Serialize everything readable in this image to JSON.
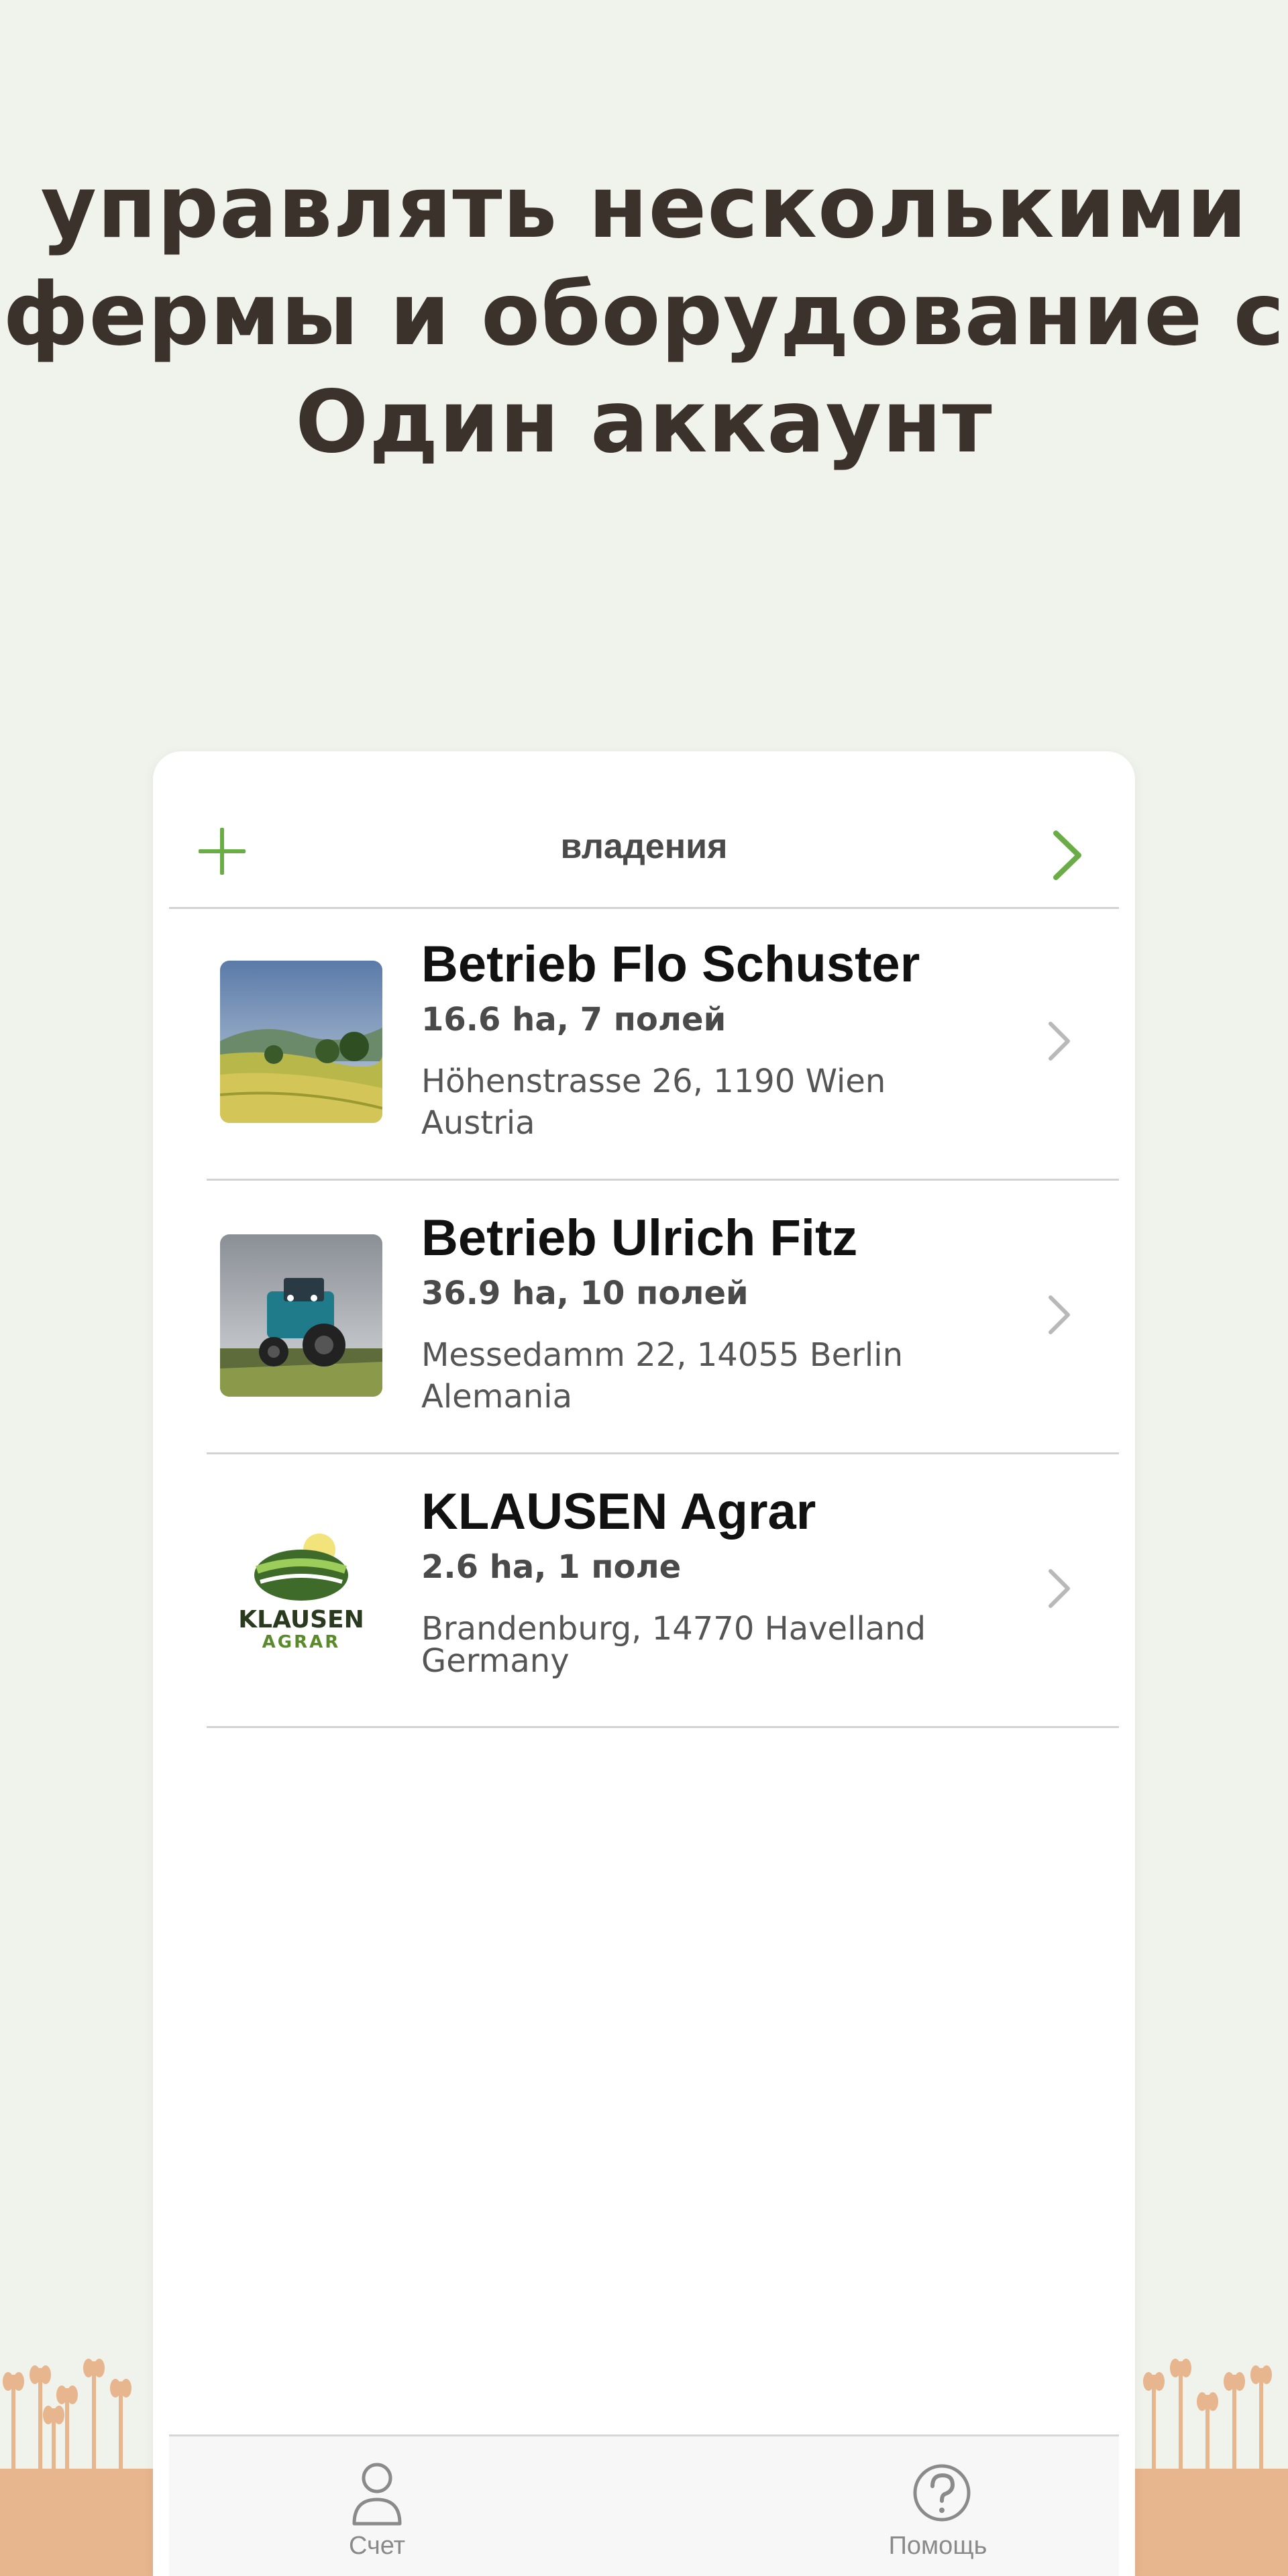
{
  "headline": {
    "line1": "управлять несколькими",
    "line2": "фермы и оборудование с",
    "line3": "Один аккаунт"
  },
  "header": {
    "title": "владения"
  },
  "farms": [
    {
      "name": "Betrieb Flo Schuster",
      "meta": "16.6 ha, 7 полей",
      "address_line1": "Höhenstrasse 26, 1190 Wien",
      "address_line2": "Austria",
      "thumbnail": "landscape-photo"
    },
    {
      "name": "Betrieb Ulrich Fitz",
      "meta": "36.9 ha, 10 полей",
      "address_line1": "Messedamm 22, 14055 Berlin",
      "address_line2": "Alemania",
      "thumbnail": "tractor-photo"
    },
    {
      "name": "KLAUSEN Agrar",
      "meta": "2.6 ha, 1 поле",
      "address_line1": "Brandenburg, 14770  Havelland",
      "address_line2": "Germany",
      "thumbnail": "klausen-logo",
      "logo_text_1": "KLAUSEN",
      "logo_text_2": "AGRAR"
    }
  ],
  "tabbar": {
    "account_label": "Счет",
    "help_label": "Помощь"
  },
  "colors": {
    "accent": "#6aac45",
    "background": "#f0f3eb",
    "headline": "#3b322b",
    "wheat": "#e7b58e"
  },
  "icons": [
    "plus-icon",
    "chevron-right-icon",
    "person-icon",
    "question-circle-icon",
    "wheat-decoration"
  ]
}
